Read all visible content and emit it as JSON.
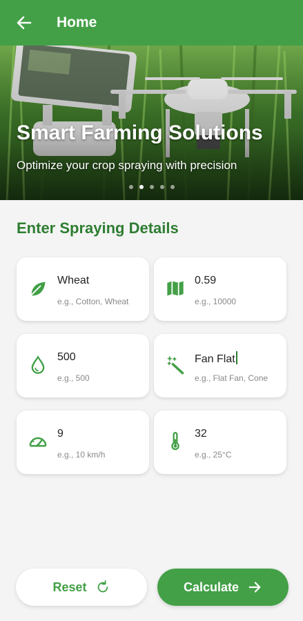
{
  "appbar": {
    "title": "Home"
  },
  "banner": {
    "title": "Smart Farming Solutions",
    "subtitle": "Optimize your crop spraying with precision",
    "active_slide": 2,
    "slide_count": 5
  },
  "form": {
    "section_title": "Enter Spraying Details",
    "fields": [
      {
        "icon": "leaf-icon",
        "value": "Wheat",
        "placeholder": "e.g., Cotton, Wheat"
      },
      {
        "icon": "map-icon",
        "value": "0.59",
        "placeholder": "e.g., 10000"
      },
      {
        "icon": "water-drop-icon",
        "value": "500",
        "placeholder": "e.g., 500"
      },
      {
        "icon": "magic-wand-icon",
        "value": "Fan Flat",
        "placeholder": "e.g., Flat Fan, Cone"
      },
      {
        "icon": "speedometer-icon",
        "value": "9",
        "placeholder": "e.g., 10 km/h"
      },
      {
        "icon": "thermometer-icon",
        "value": "32",
        "placeholder": "e.g., 25°C"
      }
    ]
  },
  "actions": {
    "reset_label": "Reset",
    "calculate_label": "Calculate"
  },
  "colors": {
    "primary": "#43a047",
    "primary_dark": "#2e7d32",
    "background": "#f4f4f4"
  }
}
